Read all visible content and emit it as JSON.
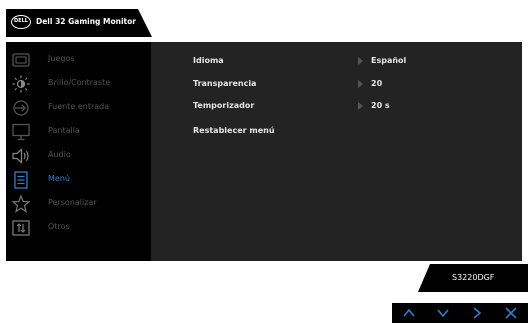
{
  "header": {
    "logo_text": "DELL",
    "title": "Dell 32 Gaming Monitor"
  },
  "menu": {
    "items": [
      {
        "label": "Juegos",
        "icon": "gamepad-icon",
        "active": false
      },
      {
        "label": "Brillo/Contraste",
        "icon": "brightness-icon",
        "active": false
      },
      {
        "label": "Fuente entrada",
        "icon": "input-source-icon",
        "active": false
      },
      {
        "label": "Pantalla",
        "icon": "display-icon",
        "active": false
      },
      {
        "label": "Audio",
        "icon": "speaker-icon",
        "active": false
      },
      {
        "label": "Menú",
        "icon": "menu-icon",
        "active": true
      },
      {
        "label": "Personalizar",
        "icon": "star-icon",
        "active": false
      },
      {
        "label": "Otros",
        "icon": "others-icon",
        "active": false
      }
    ]
  },
  "settings": {
    "rows": [
      {
        "label": "Idioma",
        "value": "Español"
      },
      {
        "label": "Transparencia",
        "value": "20"
      },
      {
        "label": "Temporizador",
        "value": "20 s"
      },
      {
        "label": "Restablecer menú",
        "value": null
      }
    ]
  },
  "model": "S3220DGF",
  "nav_buttons": [
    "up-arrow-icon",
    "down-arrow-icon",
    "right-arrow-icon",
    "close-icon"
  ],
  "colors": {
    "accent": "#2d7fd0",
    "panel": "#232323",
    "menu_bg": "#000000",
    "nav_icons": "#2d7fd0"
  }
}
